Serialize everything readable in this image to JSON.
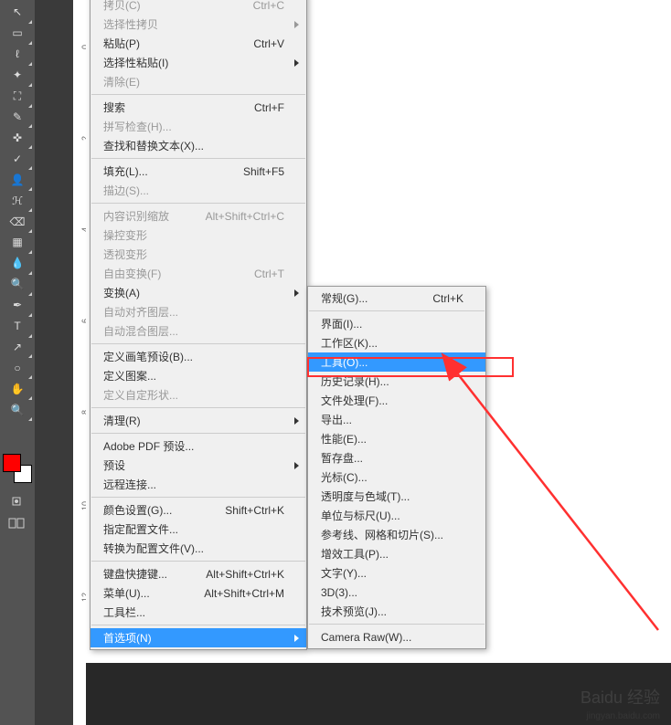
{
  "toolbar": {
    "tools": [
      {
        "name": "move-tool",
        "glyph": "↖"
      },
      {
        "name": "marquee-tool",
        "glyph": "▭"
      },
      {
        "name": "lasso-tool",
        "glyph": "ℓ"
      },
      {
        "name": "wand-tool",
        "glyph": "✦"
      },
      {
        "name": "crop-tool",
        "glyph": "⛶"
      },
      {
        "name": "eyedropper-tool",
        "glyph": "✎"
      },
      {
        "name": "healing-tool",
        "glyph": "✜"
      },
      {
        "name": "brush-tool",
        "glyph": "✓"
      },
      {
        "name": "stamp-tool",
        "glyph": "👤"
      },
      {
        "name": "history-brush-tool",
        "glyph": "ℋ"
      },
      {
        "name": "eraser-tool",
        "glyph": "⌫"
      },
      {
        "name": "gradient-tool",
        "glyph": "▦"
      },
      {
        "name": "blur-tool",
        "glyph": "💧"
      },
      {
        "name": "dodge-tool",
        "glyph": "🔍"
      },
      {
        "name": "pen-tool",
        "glyph": "✒"
      },
      {
        "name": "type-tool",
        "glyph": "T"
      },
      {
        "name": "path-tool",
        "glyph": "↗"
      },
      {
        "name": "shape-tool",
        "glyph": "○"
      },
      {
        "name": "hand-tool",
        "glyph": "✋"
      },
      {
        "name": "zoom-tool",
        "glyph": "🔍"
      }
    ],
    "swatch_fg": "#ff0000",
    "swatch_bg": "#ffffff"
  },
  "ruler_ticks": [
    {
      "pos": 44,
      "label": "0"
    },
    {
      "pos": 144,
      "label": "2"
    },
    {
      "pos": 244,
      "label": "4"
    },
    {
      "pos": 344,
      "label": "6"
    },
    {
      "pos": 444,
      "label": "8"
    },
    {
      "pos": 544,
      "label": "10"
    },
    {
      "pos": 644,
      "label": "12"
    }
  ],
  "menu1": {
    "groups": [
      [
        {
          "label": "拷贝(C)",
          "shortcut": "Ctrl+C",
          "disabled": true
        },
        {
          "label": "选择性拷贝",
          "arrow": true,
          "disabled": true
        },
        {
          "label": "粘贴(P)",
          "shortcut": "Ctrl+V"
        },
        {
          "label": "选择性粘贴(I)",
          "arrow": true
        },
        {
          "label": "清除(E)",
          "disabled": true
        }
      ],
      [
        {
          "label": "搜索",
          "shortcut": "Ctrl+F"
        },
        {
          "label": "拼写检查(H)...",
          "disabled": true
        },
        {
          "label": "查找和替换文本(X)..."
        }
      ],
      [
        {
          "label": "填充(L)...",
          "shortcut": "Shift+F5"
        },
        {
          "label": "描边(S)...",
          "disabled": true
        }
      ],
      [
        {
          "label": "内容识别缩放",
          "shortcut": "Alt+Shift+Ctrl+C",
          "disabled": true
        },
        {
          "label": "操控变形",
          "disabled": true
        },
        {
          "label": "透视变形",
          "disabled": true
        },
        {
          "label": "自由变换(F)",
          "shortcut": "Ctrl+T",
          "disabled": true
        },
        {
          "label": "变换(A)",
          "arrow": true
        },
        {
          "label": "自动对齐图层...",
          "disabled": true
        },
        {
          "label": "自动混合图层...",
          "disabled": true
        }
      ],
      [
        {
          "label": "定义画笔预设(B)..."
        },
        {
          "label": "定义图案..."
        },
        {
          "label": "定义自定形状...",
          "disabled": true
        }
      ],
      [
        {
          "label": "清理(R)",
          "arrow": true
        }
      ],
      [
        {
          "label": "Adobe PDF 预设..."
        },
        {
          "label": "预设",
          "arrow": true
        },
        {
          "label": "远程连接..."
        }
      ],
      [
        {
          "label": "颜色设置(G)...",
          "shortcut": "Shift+Ctrl+K"
        },
        {
          "label": "指定配置文件..."
        },
        {
          "label": "转换为配置文件(V)..."
        }
      ],
      [
        {
          "label": "键盘快捷键...",
          "shortcut": "Alt+Shift+Ctrl+K"
        },
        {
          "label": "菜单(U)...",
          "shortcut": "Alt+Shift+Ctrl+M"
        },
        {
          "label": "工具栏..."
        }
      ],
      [
        {
          "label": "首选项(N)",
          "arrow": true,
          "highlight": true
        }
      ]
    ]
  },
  "menu2": {
    "groups": [
      [
        {
          "label": "常规(G)...",
          "shortcut": "Ctrl+K"
        }
      ],
      [
        {
          "label": "界面(I)..."
        },
        {
          "label": "工作区(K)..."
        },
        {
          "label": "工具(O)...",
          "highlight": true
        },
        {
          "label": "历史记录(H)..."
        },
        {
          "label": "文件处理(F)..."
        },
        {
          "label": "导出..."
        },
        {
          "label": "性能(E)..."
        },
        {
          "label": "暂存盘..."
        },
        {
          "label": "光标(C)..."
        },
        {
          "label": "透明度与色域(T)..."
        },
        {
          "label": "单位与标尺(U)..."
        },
        {
          "label": "参考线、网格和切片(S)..."
        },
        {
          "label": "增效工具(P)..."
        },
        {
          "label": "文字(Y)..."
        },
        {
          "label": "3D(3)..."
        },
        {
          "label": "技术预览(J)..."
        }
      ],
      [
        {
          "label": "Camera Raw(W)..."
        }
      ]
    ]
  },
  "watermark": {
    "main": "Baidu 经验",
    "sub": "jingyan.baidu.com"
  }
}
